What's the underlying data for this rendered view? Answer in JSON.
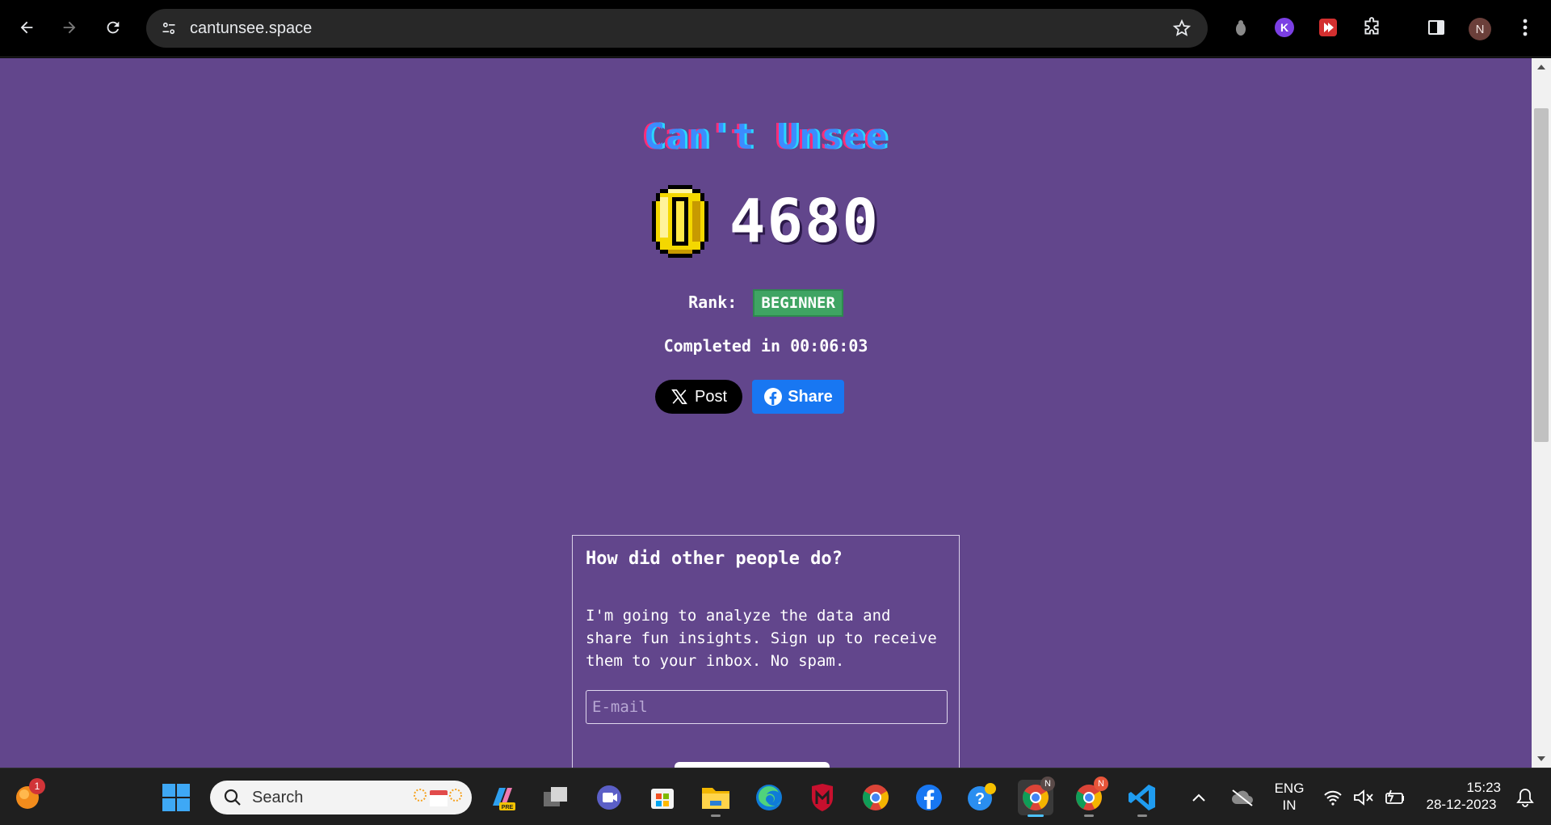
{
  "browser": {
    "url": "cantunsee.space",
    "profile_initial": "N"
  },
  "page": {
    "title": "Can't Unsee",
    "score": "4680",
    "rank_label": "Rank:",
    "rank_value": "BEGINNER",
    "completed": "Completed in 00:06:03",
    "share_x_label": "Post",
    "share_fb_label": "Share",
    "card": {
      "title": "How did other people do?",
      "text": "I'm going to analyze the data and share fun insights. Sign up to receive them to your inbox. No spam.",
      "email_placeholder": "E-mail"
    }
  },
  "taskbar": {
    "search_label": "Search",
    "lang_line1": "ENG",
    "lang_line2": "IN",
    "time": "15:23",
    "date": "28-12-2023",
    "notification_count": "1",
    "chrome_profile_1": "N",
    "chrome_profile_2": "N"
  },
  "colors": {
    "page_bg": "#62468c",
    "rank_badge": "#3fa463",
    "facebook": "#1877f2"
  }
}
